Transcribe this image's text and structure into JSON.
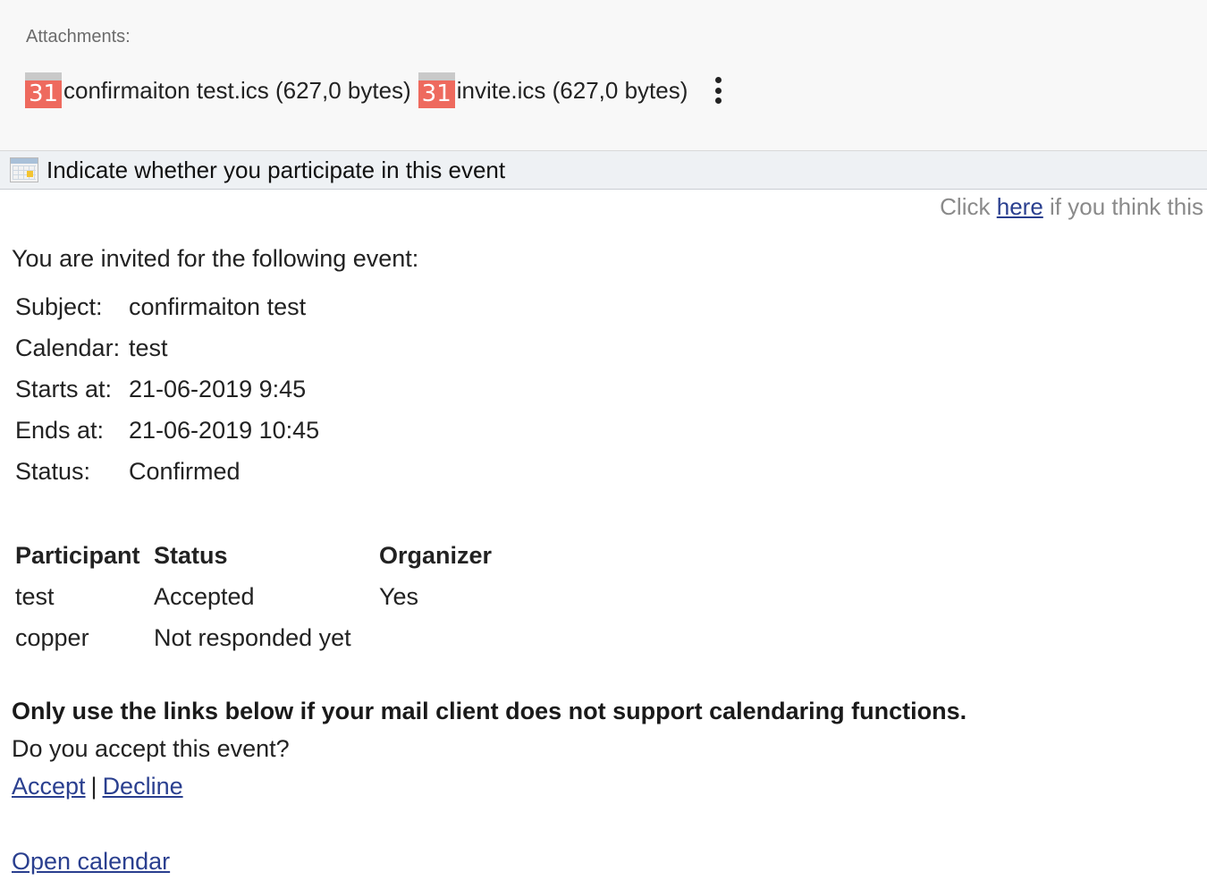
{
  "attachments": {
    "label": "Attachments:",
    "items": [
      {
        "icon_text": "31",
        "name": "confirmaiton test.ics (627,0 bytes)"
      },
      {
        "icon_text": "31",
        "name": "invite.ics (627,0 bytes)"
      }
    ]
  },
  "invite_bar": {
    "icon": "calendar-icon",
    "text": "Indicate whether you participate in this event"
  },
  "notice": {
    "prefix": "Click",
    "link": "here",
    "suffix": "if you think this"
  },
  "event": {
    "intro": "You are invited for the following event:",
    "details": [
      {
        "label": "Subject:",
        "value": "confirmaiton test"
      },
      {
        "label": "Calendar:",
        "value": "test"
      },
      {
        "label": "Starts at:",
        "value": "21-06-2019 9:45"
      },
      {
        "label": "Ends at:",
        "value": "21-06-2019 10:45"
      },
      {
        "label": "Status:",
        "value": "Confirmed"
      }
    ]
  },
  "participants": {
    "headers": [
      "Participant",
      "Status",
      "Organizer"
    ],
    "rows": [
      [
        "test",
        "Accepted",
        "Yes"
      ],
      [
        "copper",
        "Not responded yet",
        ""
      ]
    ]
  },
  "footer": {
    "warning": "Only use the links below if your mail client does not support calendaring functions.",
    "question": "Do you accept this event?",
    "accept": "Accept",
    "separator": "|",
    "decline": "Decline",
    "open_calendar": "Open calendar"
  },
  "colors": {
    "link": "#2a3f8f",
    "ics_icon": "#ee6a5e",
    "bar_background": "#eef1f4"
  }
}
